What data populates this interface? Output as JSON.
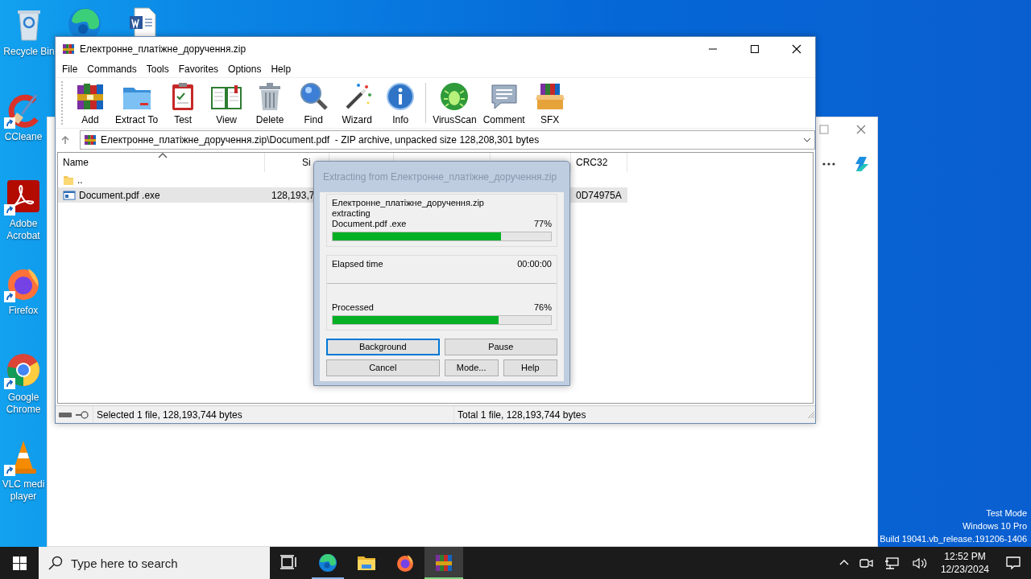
{
  "desktop": {
    "icons": [
      {
        "kind": "recycle-bin",
        "label": "Recycle Bin",
        "shortcut": false
      },
      {
        "kind": "edge",
        "shortcut": false
      },
      {
        "kind": "word-doc",
        "shortcut": false
      },
      {
        "kind": "ccleaner",
        "label": "CCleane",
        "shortcut": true
      },
      {
        "kind": "acrobat",
        "label": "Adobe Acrobat",
        "shortcut": true
      },
      {
        "kind": "firefox",
        "label": "Firefox",
        "shortcut": true
      },
      {
        "kind": "chrome",
        "label": "Google Chrome",
        "shortcut": true
      },
      {
        "kind": "vlc",
        "label": "VLC medi player",
        "shortcut": true
      }
    ]
  },
  "system_notice": [
    "Test Mode",
    "Windows 10 Pro",
    "Build 19041.vb_release.191206-1406"
  ],
  "winrar": {
    "title": "Електронне_платіжне_доручення.zip",
    "menu": [
      "File",
      "Commands",
      "Tools",
      "Favorites",
      "Options",
      "Help"
    ],
    "toolbar": [
      {
        "kind": "add",
        "label": "Add"
      },
      {
        "kind": "extract",
        "label": "Extract To"
      },
      {
        "kind": "test",
        "label": "Test"
      },
      {
        "kind": "view",
        "label": "View"
      },
      {
        "kind": "delete",
        "label": "Delete"
      },
      {
        "kind": "find",
        "label": "Find"
      },
      {
        "kind": "wizard",
        "label": "Wizard"
      },
      {
        "kind": "info",
        "label": "Info"
      },
      {
        "kind": "separator"
      },
      {
        "kind": "virusscan",
        "label": "VirusScan"
      },
      {
        "kind": "comment",
        "label": "Comment"
      },
      {
        "kind": "sfx",
        "label": "SFX"
      }
    ],
    "address": "Електронне_платіжне_доручення.zip\\Document.pdf  - ZIP archive, unpacked size 128,208,301 bytes",
    "columns": [
      {
        "kind": "name",
        "label": "Name",
        "sorted": true
      },
      {
        "kind": "size",
        "label": "Si",
        "sorted": false
      },
      {
        "kind": "crc",
        "label": "CRC32",
        "sorted": false
      }
    ],
    "rows": [
      {
        "kind": "folder",
        "name": "..",
        "selected": false
      },
      {
        "kind": "file",
        "name": "Document.pdf .exe",
        "size": "128,193,7",
        "crc": "0D74975A",
        "selected": true
      }
    ],
    "status": {
      "left": "Selected 1 file, 128,193,744 bytes",
      "right": "Total 1 file, 128,193,744 bytes"
    }
  },
  "dialog": {
    "title": "Extracting from Електронне_платіжне_доручення.zip",
    "archive": "Електронне_платіжне_доручення.zip",
    "action": "extracting",
    "file": "Document.pdf .exe",
    "file_progress": {
      "percent": "77%",
      "level": 0.77
    },
    "elapsed_label": "Elapsed time",
    "elapsed": "00:00:00",
    "processed_label": "Processed",
    "processed": {
      "percent": "76%",
      "level": 0.76
    },
    "buttons": [
      {
        "label": "Background",
        "focused": true
      },
      {
        "label": "Pause",
        "focused": false
      },
      {
        "label": "Cancel",
        "focused": false
      },
      {
        "label": "Mode...",
        "focused": false
      },
      {
        "label": "Help",
        "focused": false
      }
    ]
  },
  "taskbar": {
    "search_placeholder": "Type here to search",
    "apps": [
      {
        "kind": "task-view",
        "running": false,
        "active": false
      },
      {
        "kind": "edge",
        "running": true,
        "active": false
      },
      {
        "kind": "explorer",
        "running": false,
        "active": false
      },
      {
        "kind": "firefox",
        "running": false,
        "active": false
      },
      {
        "kind": "winrar",
        "running": true,
        "active": true
      }
    ],
    "time": "12:52 PM",
    "date": "12/23/2024"
  }
}
